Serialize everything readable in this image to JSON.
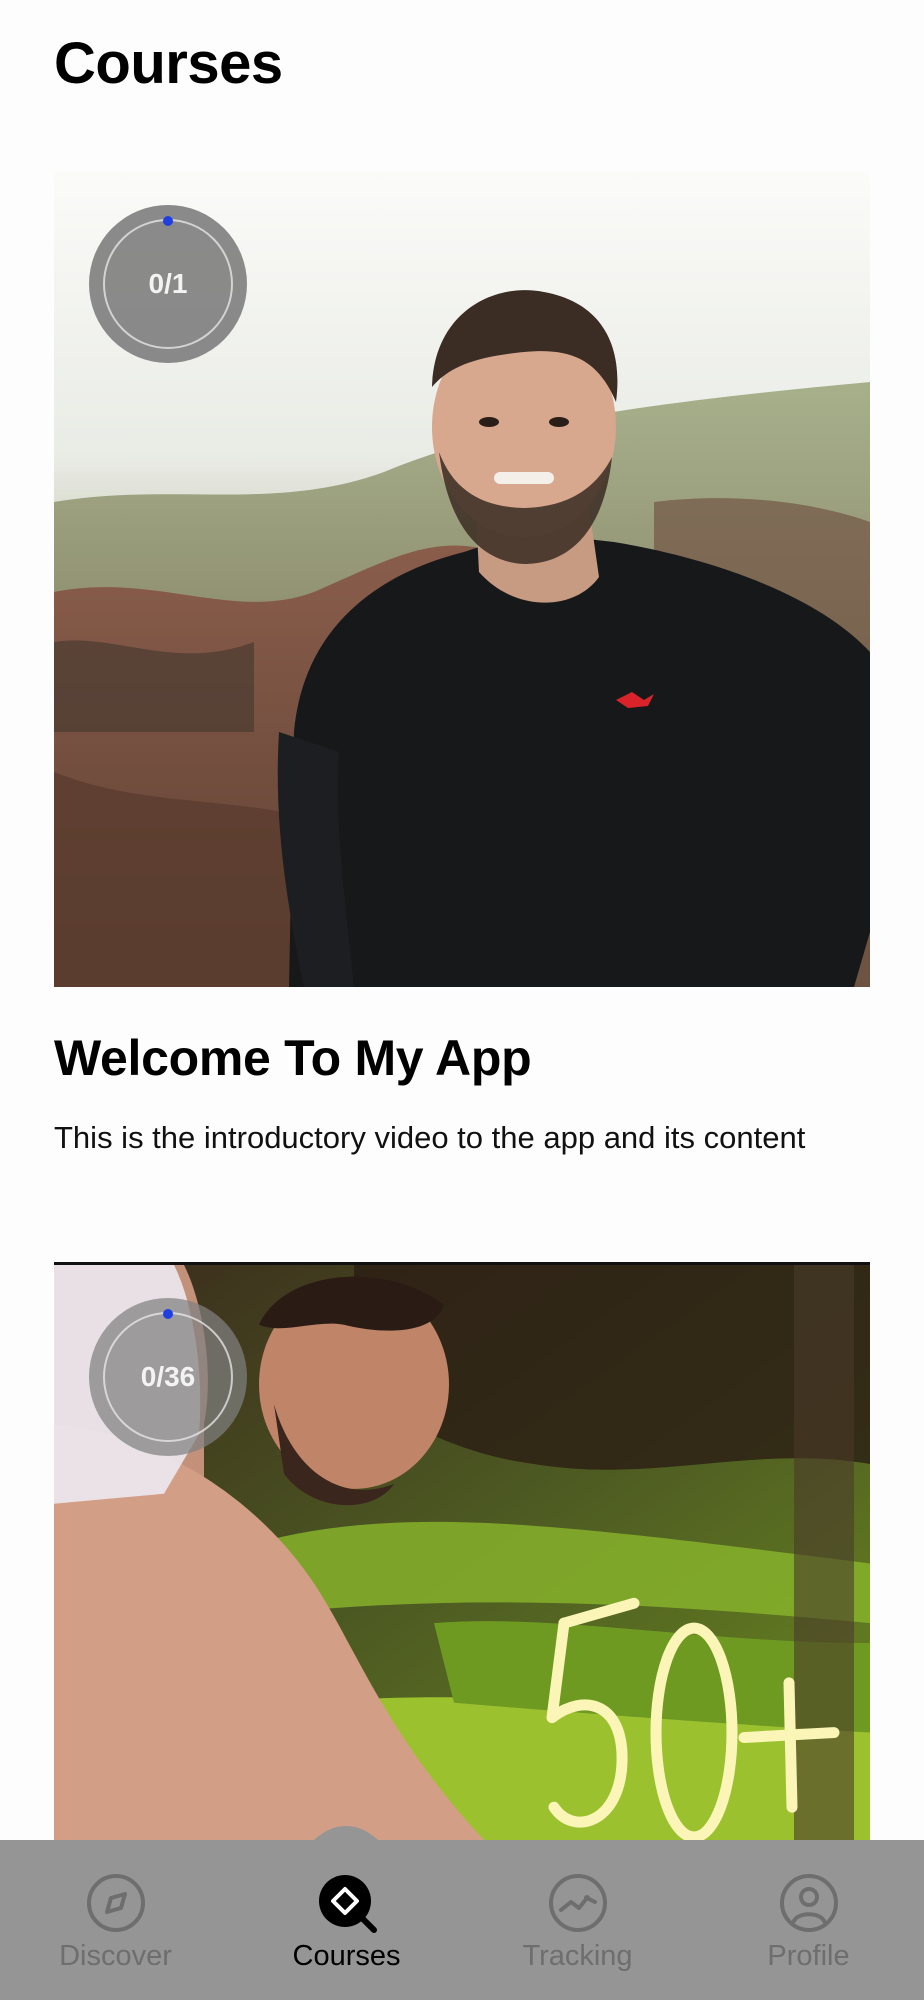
{
  "header": {
    "title": "Courses"
  },
  "courses": [
    {
      "title": "Welcome To My App",
      "description": "This is the introductory video to the app and its content",
      "progress_label": "0/1",
      "progress": 0
    },
    {
      "title": "",
      "description": "",
      "progress_label": "0/36",
      "progress": 0,
      "thumbnail_text": "50+"
    }
  ],
  "nav": {
    "items": [
      {
        "label": "Discover",
        "icon": "compass-icon",
        "active": false
      },
      {
        "label": "Courses",
        "icon": "courses-icon",
        "active": true
      },
      {
        "label": "Tracking",
        "icon": "tracking-icon",
        "active": false
      },
      {
        "label": "Profile",
        "icon": "profile-icon",
        "active": false
      }
    ]
  },
  "colors": {
    "progress_dot": "#1f3fe0",
    "nav_background": "#959595",
    "nav_inactive": "#6e6e6e",
    "nav_active": "#000000"
  }
}
